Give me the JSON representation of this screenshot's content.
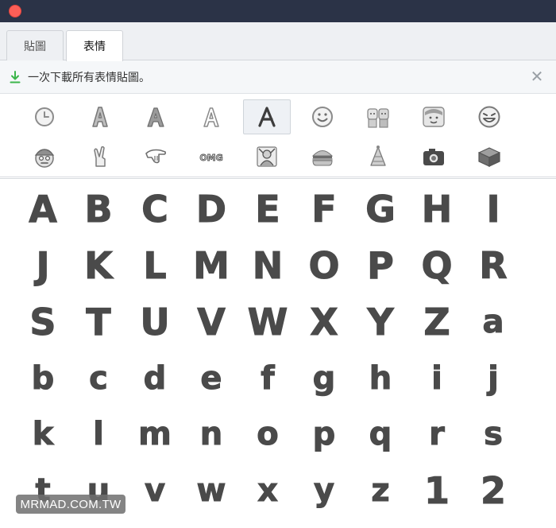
{
  "window": {
    "close_color": "#fc5f57",
    "titlebar_color": "#2b3347"
  },
  "tabs": [
    {
      "label": "貼圖",
      "active": false
    },
    {
      "label": "表情",
      "active": true
    }
  ],
  "banner": {
    "text": "一次下載所有表情貼圖。",
    "icon": "download-icon",
    "close_icon": "close-icon",
    "close_glyph": "✕",
    "icon_color": "#3bb54a"
  },
  "picker": {
    "row1": [
      "clock-icon",
      "letter-a-bubble-icon",
      "letter-a-gray-icon",
      "letter-a-outline-icon",
      "letter-a-handwritten-icon",
      "smiley-face-icon",
      "couple-icon",
      "girl-face-icon",
      "grinning-face-icon"
    ],
    "row2": [
      "boy-cap-icon",
      "crossed-fingers-icon",
      "pointing-hand-icon",
      "omg-text-icon",
      "warrior-icon",
      "burger-icon",
      "party-hat-icon",
      "camera-icon",
      "gift-box-icon"
    ],
    "row2_omg_text": "OMG",
    "selected_index": 4
  },
  "letters": {
    "row1": [
      "A",
      "B",
      "C",
      "D",
      "E",
      "F",
      "G",
      "H",
      "I"
    ],
    "row2": [
      "J",
      "K",
      "L",
      "M",
      "N",
      "O",
      "P",
      "Q",
      "R"
    ],
    "row3": [
      "S",
      "T",
      "U",
      "V",
      "W",
      "X",
      "Y",
      "Z",
      "a"
    ],
    "row4": [
      "b",
      "c",
      "d",
      "e",
      "f",
      "g",
      "h",
      "i",
      "j"
    ],
    "row5": [
      "k",
      "l",
      "m",
      "n",
      "o",
      "p",
      "q",
      "r",
      "s"
    ],
    "row6": [
      "t",
      "u",
      "v",
      "w",
      "x",
      "y",
      "z",
      "1",
      "2"
    ]
  },
  "watermark": "MRMAD.COM.TW"
}
